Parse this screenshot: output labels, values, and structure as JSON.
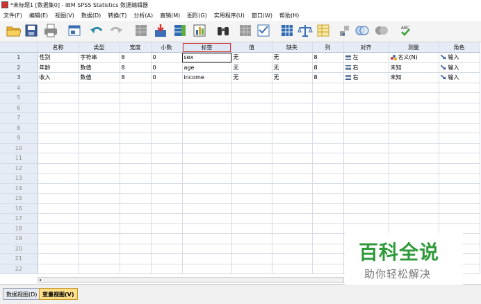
{
  "window": {
    "title": "*未标题1 [数据集0] - IBM SPSS Statistics 数据编辑器"
  },
  "menu": [
    "文件(F)",
    "编辑(E)",
    "视图(V)",
    "数据(D)",
    "转换(T)",
    "分析(A)",
    "直销(M)",
    "图形(G)",
    "实用程序(U)",
    "窗口(W)",
    "帮助(H)"
  ],
  "toolbar": {
    "icons": [
      "open-folder-icon",
      "save-icon",
      "print-icon",
      "dialog-recall-icon",
      "undo-icon",
      "redo-icon",
      "goto-case-icon",
      "goto-variable-icon",
      "variables-icon",
      "run-descriptives-icon",
      "find-icon",
      "insert-cases-icon",
      "insert-variable-icon",
      "split-file-icon",
      "weight-cases-icon",
      "select-cases-icon",
      "value-labels-icon",
      "use-variable-sets-icon",
      "show-all-variables-icon",
      "spell-check-icon"
    ],
    "spell_label": "ABC"
  },
  "grid": {
    "headers": [
      "名称",
      "类型",
      "宽度",
      "小数",
      "标签",
      "值",
      "缺失",
      "列",
      "对齐",
      "测量",
      "角色"
    ],
    "rows": [
      {
        "num": "1",
        "name": "性别",
        "type": "字符串",
        "width": "8",
        "decimals": "0",
        "label": "sex",
        "values": "无",
        "missing": "无",
        "columns": "8",
        "align": "左",
        "measure": "名义(N)",
        "role": "输入"
      },
      {
        "num": "2",
        "name": "年龄",
        "type": "数值",
        "width": "8",
        "decimals": "0",
        "label": "age",
        "values": "无",
        "missing": "无",
        "columns": "8",
        "align": "右",
        "measure": "未知",
        "role": "输入"
      },
      {
        "num": "3",
        "name": "收入",
        "type": "数值",
        "width": "8",
        "decimals": "0",
        "label": "income",
        "values": "无",
        "missing": "无",
        "columns": "8",
        "align": "右",
        "measure": "未知",
        "role": "输入"
      }
    ],
    "empty_rows": [
      "4",
      "5",
      "6",
      "7",
      "8",
      "9",
      "10",
      "11",
      "12",
      "13",
      "14",
      "15",
      "16",
      "17",
      "18",
      "19",
      "20",
      "21",
      "22"
    ]
  },
  "tabs": {
    "data_view": "数据视图(D)",
    "variable_view": "变量视图(V)"
  },
  "watermark": {
    "line1": "百科全说",
    "line2": "助你轻松解决"
  }
}
